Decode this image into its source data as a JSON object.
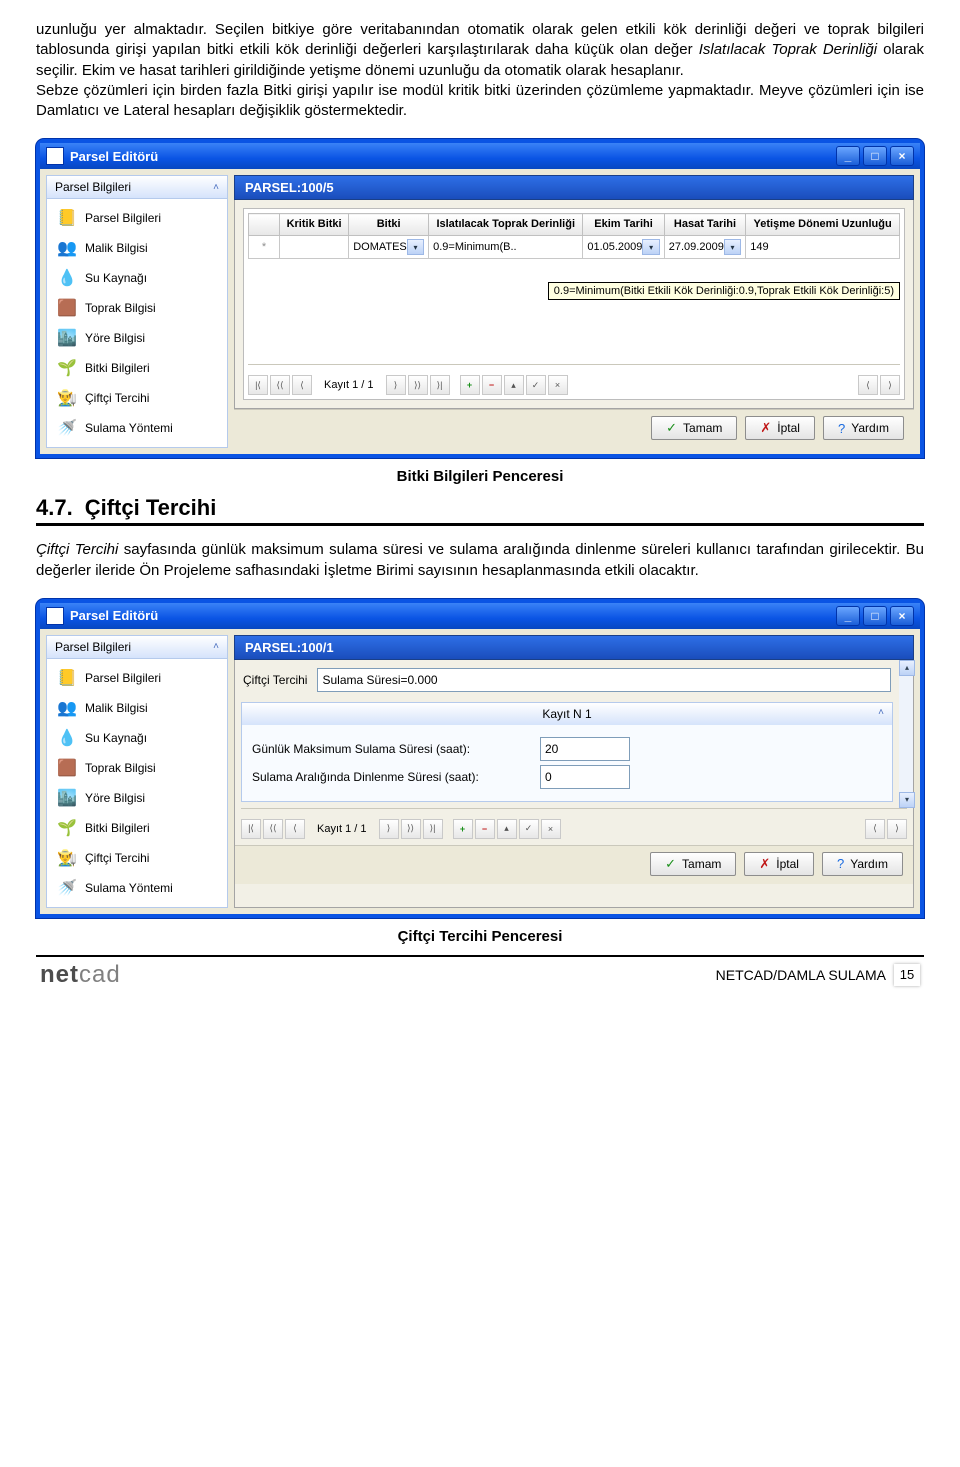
{
  "paragraph": "uzunluğu yer almaktadır. Seçilen bitkiye göre veritabanından otomatik olarak gelen etkili kök derinliği değeri ve toprak bilgileri tablosunda girişi yapılan bitki etkili kök derinliği değerleri karşılaştırılarak daha küçük olan değer Islatılacak Toprak Derinliği olarak seçilir. Ekim ve hasat tarihleri girildiğinde yetişme dönemi uzunluğu da otomatik olarak hesaplanır.",
  "paragraph2": "Sebze çözümleri için birden fazla Bitki girişi yapılır ise modül kritik bitki üzerinden çözümleme yapmaktadır. Meyve çözümleri için ise Damlatıcı ve Lateral hesapları değişiklik göstermektedir.",
  "italic_term": "Islatılacak Toprak Derinliği",
  "window_title": "Parsel Editörü",
  "sidebar_title": "Parsel Bilgileri",
  "sidebar": [
    {
      "label": "Parsel Bilgileri",
      "icon": "📒"
    },
    {
      "label": "Malik Bilgisi",
      "icon": "👥"
    },
    {
      "label": "Su Kaynağı",
      "icon": "💧"
    },
    {
      "label": "Toprak Bilgisi",
      "icon": "🟫"
    },
    {
      "label": "Yöre Bilgisi",
      "icon": "🏙️"
    },
    {
      "label": "Bitki Bilgileri",
      "icon": "🌱"
    },
    {
      "label": "Çiftçi Tercihi",
      "icon": "👨‍🌾"
    },
    {
      "label": "Sulama Yöntemi",
      "icon": "🚿"
    }
  ],
  "main1": {
    "header": "PARSEL:100/5",
    "columns": [
      "Kritik Bitki",
      "Bitki",
      "Islatılacak Toprak Derinliği",
      "Ekim Tarihi",
      "Hasat Tarihi",
      "Yetişme Dönemi Uzunluğu"
    ],
    "row": {
      "kritik": "",
      "bitki": "DOMATES",
      "derinlik": "0.9=Minimum(B..",
      "ekim": "01.05.2009",
      "hasat": "27.09.2009",
      "uzunluk": "149"
    },
    "tooltip": "0.9=Minimum(Bitki Etkili Kök Derinliği:0.9,Toprak Etkili Kök Derinliği:5)",
    "record": "Kayıt 1 / 1"
  },
  "caption1": "Bitki Bilgileri Penceresi",
  "section": {
    "num": "4.7.",
    "title": "Çiftçi Tercihi"
  },
  "paragraph3": "Çiftçi Tercihi sayfasında günlük maksimum sulama süresi ve sulama aralığında dinlenme süreleri kullanıcı tarafından girilecektir. Bu değerler ileride Ön Projeleme safhasındaki İşletme Birimi sayısının hesaplanmasında etkili olacaktır.",
  "italic_term2": "Çiftçi Tercihi",
  "main2": {
    "header": "PARSEL:100/1",
    "field_label": "Çiftçi Tercihi",
    "field_value": "Sulama Süresi=0.000",
    "group_title": "Kayıt N 1",
    "f1_label": "Günlük Maksimum Sulama Süresi (saat):",
    "f1_value": "20",
    "f2_label": "Sulama Aralığında Dinlenme Süresi (saat):",
    "f2_value": "0",
    "record": "Kayıt 1 / 1"
  },
  "buttons": {
    "ok": "Tamam",
    "cancel": "İptal",
    "help": "Yardım"
  },
  "caption2": "Çiftçi Tercihi Penceresi",
  "footer": {
    "brand": "netcad",
    "product": "NETCAD/DAMLA SULAMA",
    "page": "15"
  }
}
